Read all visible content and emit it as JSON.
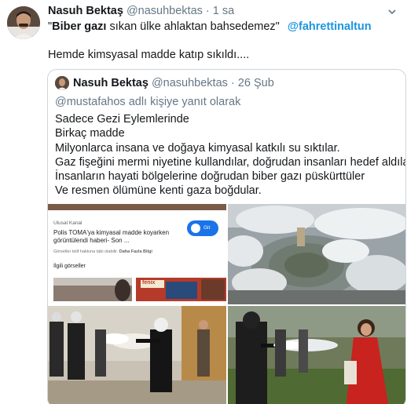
{
  "tweet": {
    "author_name": "Nasuh Bektaş",
    "author_handle": "@nasuhbektas",
    "separator": "·",
    "time": "1 sa",
    "quote_open": "\"",
    "bold_phrase": "Biber gazı",
    "text_rest": " sıkan ülke ahlaktan bahsedemez\"",
    "mention": "@fahrettinaltun",
    "text_line2": "Hemde kimsyasal madde katıp sıkıldı...."
  },
  "quoted": {
    "author_name": "Nasuh Bektaş",
    "author_handle": "@nasuhbektas",
    "separator": "·",
    "time": "26 Şub",
    "reply_to": "@mustafahos adlı kişiye yanıt olarak",
    "lines": [
      "Sadece Gezi Eylemlerinde",
      "Birkaç madde",
      "Milyonlarca insana ve doğaya kimyasal katkılı su sıktılar.",
      "Gaz fişeğini mermi niyetine kullandılar, doğrudan insanları hedef aldılar.",
      "İnsanların hayati bölgelerine doğrudan biber gazı püskürttüler",
      "Ve resmen ölümüne kenti gaza boğdular."
    ]
  },
  "media": {
    "screenshot_card": {
      "source": "Ulusal Kanal",
      "title": "Polis TOMA'ya kimyasal madde koyarken görüntülendi haberi- Son ...",
      "copyright": "Görseller telif hakkına tabi olabilir.",
      "learn_more": "Daha Fazla Bilgi",
      "visit_button": "Git",
      "related": "İlgili görseller",
      "thumb_label": "fenix"
    }
  },
  "colors": {
    "link": "#1b95e0",
    "secondary_text": "#657786",
    "border": "#ccd6dd",
    "google_blue": "#1a73e8"
  }
}
